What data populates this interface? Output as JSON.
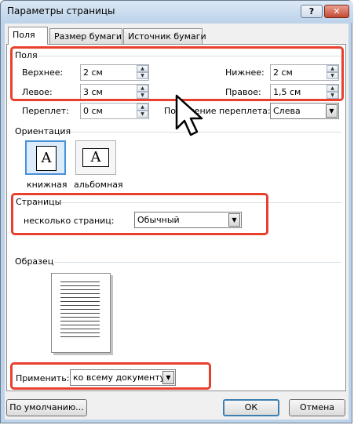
{
  "window": {
    "title": "Параметры страницы",
    "help_label": "?",
    "close_label": "✕"
  },
  "tabs": [
    {
      "label": "Поля",
      "active": true
    },
    {
      "label": "Размер бумаги",
      "active": false
    },
    {
      "label": "Источник бумаги",
      "active": false
    }
  ],
  "margins": {
    "group_label": "Поля",
    "top_label": "Верхнее:",
    "top_value": "2 см",
    "bottom_label": "Нижнее:",
    "bottom_value": "2 см",
    "left_label": "Левое:",
    "left_value": "3 см",
    "right_label": "Правое:",
    "right_value": "1,5 см",
    "gutter_label": "Переплет:",
    "gutter_value": "0 см",
    "gutter_pos_label": "Положение переплета:",
    "gutter_pos_value": "Слева"
  },
  "orientation": {
    "group_label": "Ориентация",
    "portrait_label": "книжная",
    "landscape_label": "альбомная",
    "icon_glyph": "A",
    "selected": "portrait"
  },
  "pages": {
    "group_label": "Страницы",
    "multiple_label": "несколько страниц:",
    "multiple_value": "Обычный"
  },
  "preview": {
    "group_label": "Образец"
  },
  "apply": {
    "label": "Применить:",
    "value": "ко всему документу"
  },
  "footer": {
    "default_label": "По умолчанию...",
    "ok_label": "ОК",
    "cancel_label": "Отмена"
  },
  "colors": {
    "highlight": "#e8402c",
    "title_bar": "#bcd3ea"
  }
}
